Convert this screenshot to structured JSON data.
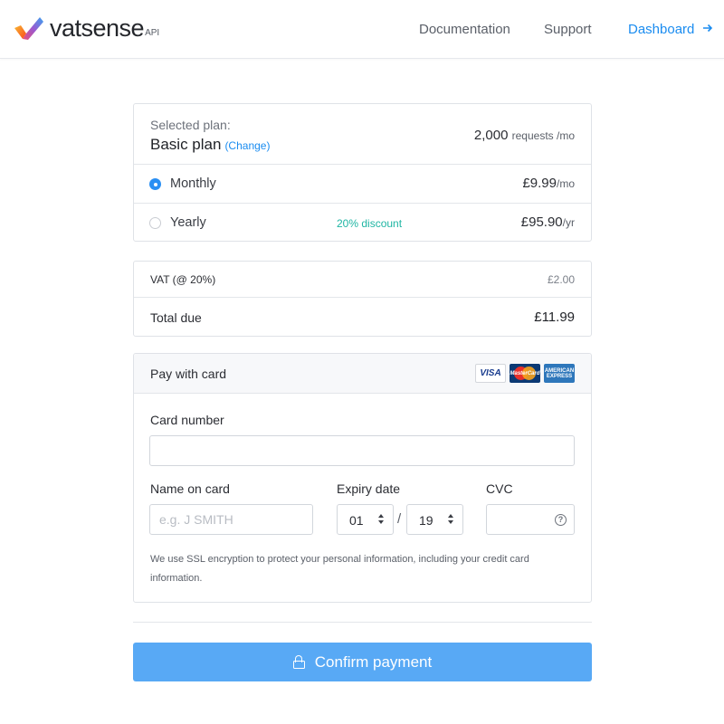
{
  "header": {
    "logo_text": "vatsense",
    "logo_suffix": "API",
    "nav": {
      "documentation": "Documentation",
      "support": "Support",
      "dashboard": "Dashboard"
    }
  },
  "plan": {
    "selected_label": "Selected plan:",
    "name": "Basic plan",
    "change_link": "(Change)",
    "requests": "2,000",
    "requests_unit": "requests /mo",
    "options": [
      {
        "label": "Monthly",
        "price": "£9.99",
        "unit": "/mo",
        "selected": true,
        "badge": ""
      },
      {
        "label": "Yearly",
        "price": "£95.90",
        "unit": "/yr",
        "selected": false,
        "badge": "20% discount"
      }
    ]
  },
  "summary": {
    "vat_label": "VAT (@ 20%)",
    "vat_value": "£2.00",
    "total_label": "Total due",
    "total_value": "£11.99"
  },
  "payment": {
    "title": "Pay with card",
    "card_brands": [
      "VISA",
      "MasterCard",
      "AMERICAN EXPRESS"
    ],
    "card_number_label": "Card number",
    "card_number_value": "",
    "name_label": "Name on card",
    "name_placeholder": "e.g. J SMITH",
    "expiry_label": "Expiry date",
    "expiry_month": "01",
    "expiry_separator": "/",
    "expiry_year": "19",
    "cvc_label": "CVC",
    "cvc_help": "?",
    "ssl_note": "We use SSL encryption to protect your personal information, including your credit card information."
  },
  "confirm_label": "Confirm payment",
  "colors": {
    "accent": "#1a8cf0",
    "button": "#58a9f5",
    "discount": "#1fb5a3"
  }
}
